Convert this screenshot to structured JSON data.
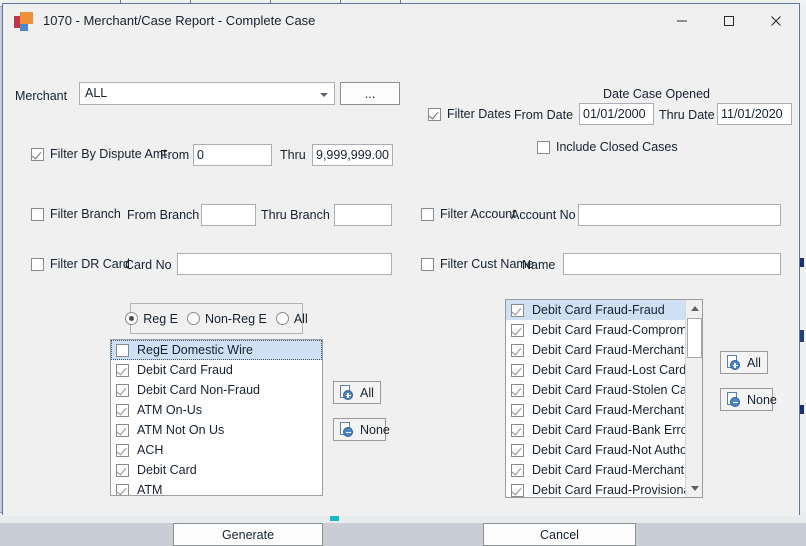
{
  "window": {
    "title": "1070 - Merchant/Case Report - Complete Case",
    "app_icon": "app-squares-icon",
    "controls": {
      "minimize": "minimize-icon",
      "maximize": "maximize-icon",
      "close": "close-icon"
    },
    "border_color": "#5b79a8",
    "face_color": "#f0f0f0"
  },
  "merchant": {
    "label": "Merchant",
    "value": "ALL",
    "browse_label": "..."
  },
  "dates": {
    "group_title": "Date Case Opened",
    "filter_label": "Filter Dates",
    "filter_checked": true,
    "from_label": "From Date",
    "from_value": "01/01/2000",
    "thru_label": "Thru Date",
    "thru_value": "11/01/2020",
    "include_closed_label": "Include Closed Cases",
    "include_closed_checked": false
  },
  "dispute": {
    "filter_label": "Filter By Dispute Amt",
    "filter_checked": true,
    "from_label": "From",
    "from_value": "0",
    "thru_label": "Thru",
    "thru_value": "9,999,999.00"
  },
  "branch": {
    "filter_label": "Filter Branch",
    "filter_checked": false,
    "from_label": "From Branch",
    "from_value": "",
    "thru_label": "Thru Branch",
    "thru_value": ""
  },
  "account": {
    "filter_label": "Filter Account",
    "filter_checked": false,
    "field_label": "Account No",
    "value": ""
  },
  "drcard": {
    "filter_label": "Filter DR Card",
    "filter_checked": false,
    "field_label": "Card No",
    "value": ""
  },
  "custname": {
    "filter_label": "Filter Cust Name",
    "filter_checked": false,
    "field_label": "Name",
    "value": ""
  },
  "reg_radio": {
    "options": [
      {
        "label": "Reg E",
        "selected": true
      },
      {
        "label": "Non-Reg E",
        "selected": false
      },
      {
        "label": "All",
        "selected": false
      }
    ]
  },
  "dispute_type_list": {
    "items": [
      {
        "label": "RegE Domestic Wire",
        "checked": false,
        "selected": true
      },
      {
        "label": "Debit Card Fraud",
        "checked": true,
        "selected": false
      },
      {
        "label": "Debit Card Non-Fraud",
        "checked": true,
        "selected": false
      },
      {
        "label": "ATM On-Us",
        "checked": true,
        "selected": false
      },
      {
        "label": "ATM Not On Us",
        "checked": true,
        "selected": false
      },
      {
        "label": "ACH",
        "checked": true,
        "selected": false
      },
      {
        "label": "Debit Card",
        "checked": true,
        "selected": false
      },
      {
        "label": "ATM",
        "checked": true,
        "selected": false
      }
    ]
  },
  "left_buttons": {
    "all_label": "All",
    "none_label": "None",
    "all_icon": "sheet-plus-icon",
    "none_icon": "sheet-minus-icon"
  },
  "reason_list": {
    "items": [
      {
        "label": "Debit Card Fraud-Fraud",
        "checked": true,
        "selected": true
      },
      {
        "label": "Debit Card Fraud-Compromised",
        "checked": true,
        "selected": false
      },
      {
        "label": "Debit Card Fraud-Merchant Erro",
        "checked": true,
        "selected": false
      },
      {
        "label": "Debit Card Fraud-Lost Card",
        "checked": true,
        "selected": false
      },
      {
        "label": "Debit Card Fraud-Stolen Card",
        "checked": true,
        "selected": false
      },
      {
        "label": "Debit Card Fraud-Merchant Den",
        "checked": true,
        "selected": false
      },
      {
        "label": "Debit Card Fraud-Bank Error",
        "checked": true,
        "selected": false
      },
      {
        "label": "Debit Card Fraud-Not Authorize",
        "checked": true,
        "selected": false
      },
      {
        "label": "Debit Card Fraud-Merchant Cre",
        "checked": true,
        "selected": false
      },
      {
        "label": "Debit Card Fraud-Provisional Re",
        "checked": true,
        "selected": false
      }
    ],
    "scrollbar": {
      "up_icon": "scroll-up-icon",
      "down_icon": "scroll-down-icon"
    }
  },
  "right_buttons": {
    "all_label": "All",
    "none_label": "None",
    "all_icon": "sheet-plus-icon",
    "none_icon": "sheet-minus-icon"
  },
  "footer": {
    "generate_label": "Generate",
    "cancel_label": "Cancel"
  }
}
